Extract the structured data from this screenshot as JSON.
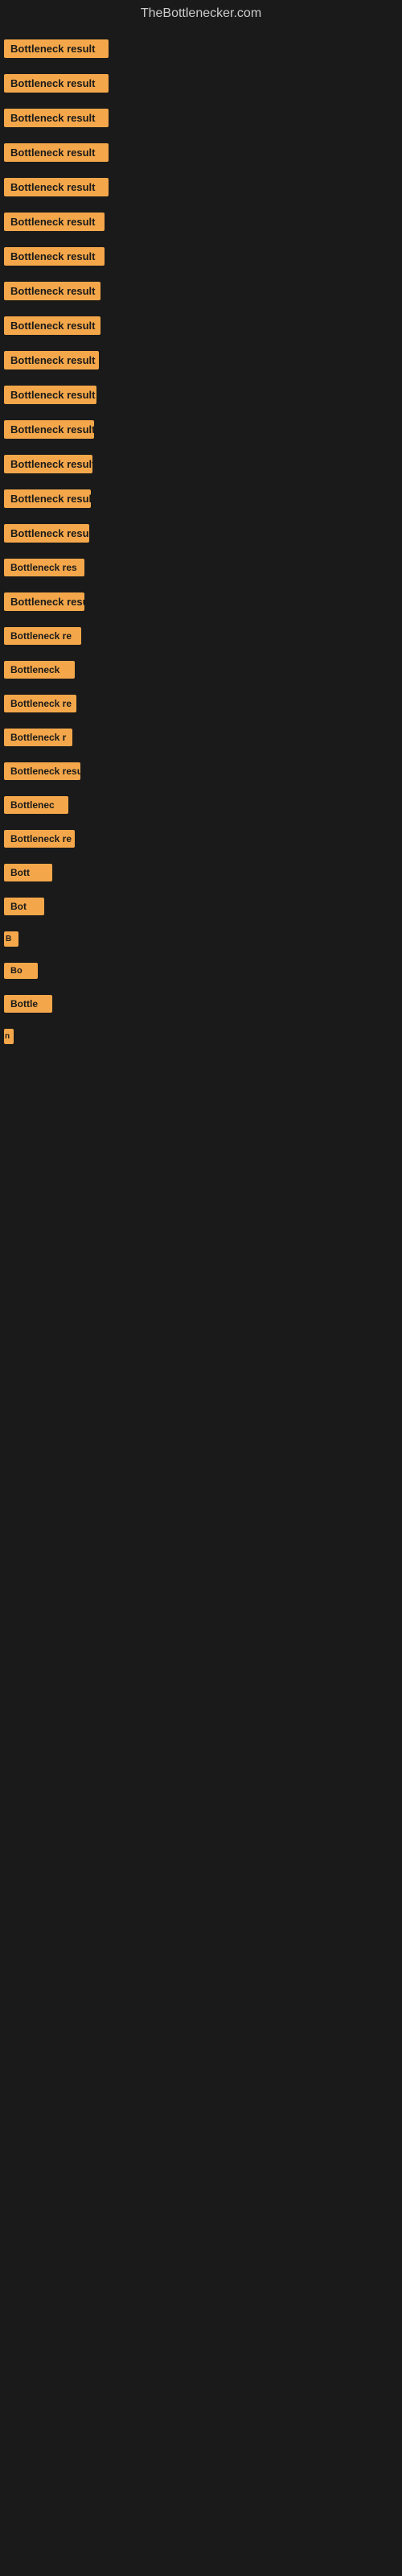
{
  "site": {
    "title": "TheBottlenecker.com"
  },
  "items": [
    {
      "id": 1,
      "label": "Bottleneck result",
      "class": "item-1"
    },
    {
      "id": 2,
      "label": "Bottleneck result",
      "class": "item-2"
    },
    {
      "id": 3,
      "label": "Bottleneck result",
      "class": "item-3"
    },
    {
      "id": 4,
      "label": "Bottleneck result",
      "class": "item-4"
    },
    {
      "id": 5,
      "label": "Bottleneck result",
      "class": "item-5"
    },
    {
      "id": 6,
      "label": "Bottleneck result",
      "class": "item-6"
    },
    {
      "id": 7,
      "label": "Bottleneck result",
      "class": "item-7"
    },
    {
      "id": 8,
      "label": "Bottleneck result",
      "class": "item-8"
    },
    {
      "id": 9,
      "label": "Bottleneck result",
      "class": "item-9"
    },
    {
      "id": 10,
      "label": "Bottleneck result",
      "class": "item-10"
    },
    {
      "id": 11,
      "label": "Bottleneck result",
      "class": "item-11"
    },
    {
      "id": 12,
      "label": "Bottleneck result",
      "class": "item-12"
    },
    {
      "id": 13,
      "label": "Bottleneck result",
      "class": "item-13"
    },
    {
      "id": 14,
      "label": "Bottleneck result",
      "class": "item-14"
    },
    {
      "id": 15,
      "label": "Bottleneck result",
      "class": "item-15"
    },
    {
      "id": 16,
      "label": "Bottleneck res",
      "class": "item-16"
    },
    {
      "id": 17,
      "label": "Bottleneck result",
      "class": "item-17"
    },
    {
      "id": 18,
      "label": "Bottleneck re",
      "class": "item-18"
    },
    {
      "id": 19,
      "label": "Bottleneck",
      "class": "item-19"
    },
    {
      "id": 20,
      "label": "Bottleneck re",
      "class": "item-20"
    },
    {
      "id": 21,
      "label": "Bottleneck r",
      "class": "item-21"
    },
    {
      "id": 22,
      "label": "Bottleneck resu",
      "class": "item-22"
    },
    {
      "id": 23,
      "label": "Bottlenec",
      "class": "item-23"
    },
    {
      "id": 24,
      "label": "Bottleneck re",
      "class": "item-24"
    },
    {
      "id": 25,
      "label": "Bott",
      "class": "item-25"
    },
    {
      "id": 26,
      "label": "Bot",
      "class": "item-26"
    },
    {
      "id": 27,
      "label": "B",
      "class": "item-27"
    },
    {
      "id": 28,
      "label": "Bo",
      "class": "item-28"
    },
    {
      "id": 29,
      "label": "Bottle",
      "class": "item-29"
    },
    {
      "id": 30,
      "label": "n",
      "class": "item-30"
    }
  ]
}
